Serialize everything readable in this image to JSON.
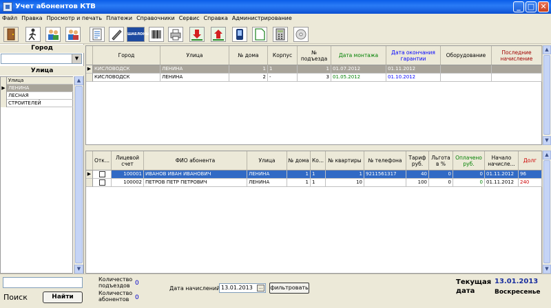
{
  "window": {
    "title": "Учет абонентов КТВ",
    "minimize": "_",
    "maximize": "□",
    "close": "✕"
  },
  "menu": [
    "Файл",
    "Правка",
    "Просмотр и печать",
    "Платежи",
    "Справочники",
    "Сервис",
    "Справка",
    "Администрирование"
  ],
  "toolbar": {
    "icons": [
      "door-icon",
      "run-icon",
      "users-add-icon",
      "users-edit-icon",
      "document-icon",
      "pen-icon",
      "label-icon",
      "barcode-icon",
      "printer-icon",
      "download-icon",
      "upload-icon",
      "phone-icon",
      "page-icon",
      "calculator-icon",
      "disc-icon"
    ],
    "label_text": "ШАБЛОНЫ"
  },
  "left": {
    "city_header": "Город",
    "city_value": "",
    "street_header": "Улица",
    "street_column": "Улица",
    "streets": [
      "ЛЕНИНА",
      "ЛЕСНАЯ",
      "СТРОИТЕЛЕЙ"
    ]
  },
  "houses": {
    "columns": [
      "Город",
      "Улица",
      "№ дома",
      "Корпус",
      "№ подъезда",
      "Дата монтажа",
      "Дата окончания гарантии",
      "Оборудование",
      "Последние начисление"
    ],
    "rows": [
      {
        "city": "КИСЛОВОДСК",
        "street": "ЛЕНИНА",
        "house": "1",
        "korpus": "1",
        "entrance": "1",
        "mount": "01.07.2012",
        "warranty": "01.11.2012",
        "equipment": "",
        "last": ""
      },
      {
        "city": "КИСЛОВОДСК",
        "street": "ЛЕНИНА",
        "house": "2",
        "korpus": "-",
        "entrance": "3",
        "mount": "01.05.2012",
        "warranty": "01.10.2012",
        "equipment": "",
        "last": ""
      }
    ]
  },
  "subscribers": {
    "columns": [
      "Отк...",
      "Лицевой счет",
      "ФИО абонента",
      "Улица",
      "№ дома",
      "Ко...",
      "№ квартиры",
      "№ телефона",
      "Тариф руб.",
      "Льгота в %",
      "Оплачено руб.",
      "Начало начисле...",
      "Долг"
    ],
    "rows": [
      {
        "account": "100001",
        "name": "ИВАНОВ ИВАН ИВАНОВИЧ",
        "street": "ЛЕНИНА",
        "house": "1",
        "ko": "1",
        "apt": "1",
        "phone": "9211561317",
        "tariff": "40",
        "discount": "0",
        "paid": "0",
        "start": "01.11.2012",
        "debt": "96"
      },
      {
        "account": "100002",
        "name": "ПЕТРОВ ПЕТР ПЕТРОВИЧ",
        "street": "ЛЕНИНА",
        "house": "1",
        "ko": "1",
        "apt": "10",
        "phone": "",
        "tariff": "100",
        "discount": "0",
        "paid": "0",
        "start": "01.11.2012",
        "debt": "240"
      }
    ]
  },
  "bottom": {
    "search_label": "Поиск",
    "find_button": "Найти",
    "entrances_label": "Количество подъездов",
    "entrances_value": "0",
    "subscribers_label": "Количество абонентов",
    "subscribers_value": "0",
    "accrual_label": "Дата начислений",
    "accrual_date": "13.01.2013",
    "filter_button": "фильтровать",
    "current_date_label": "Текущая дата",
    "current_date": "13.01.2013",
    "current_day": "Воскресенье"
  },
  "colors": {
    "accent": "#316ac5",
    "green": "#008000",
    "blue": "#0000ff",
    "red": "#cc0000"
  }
}
